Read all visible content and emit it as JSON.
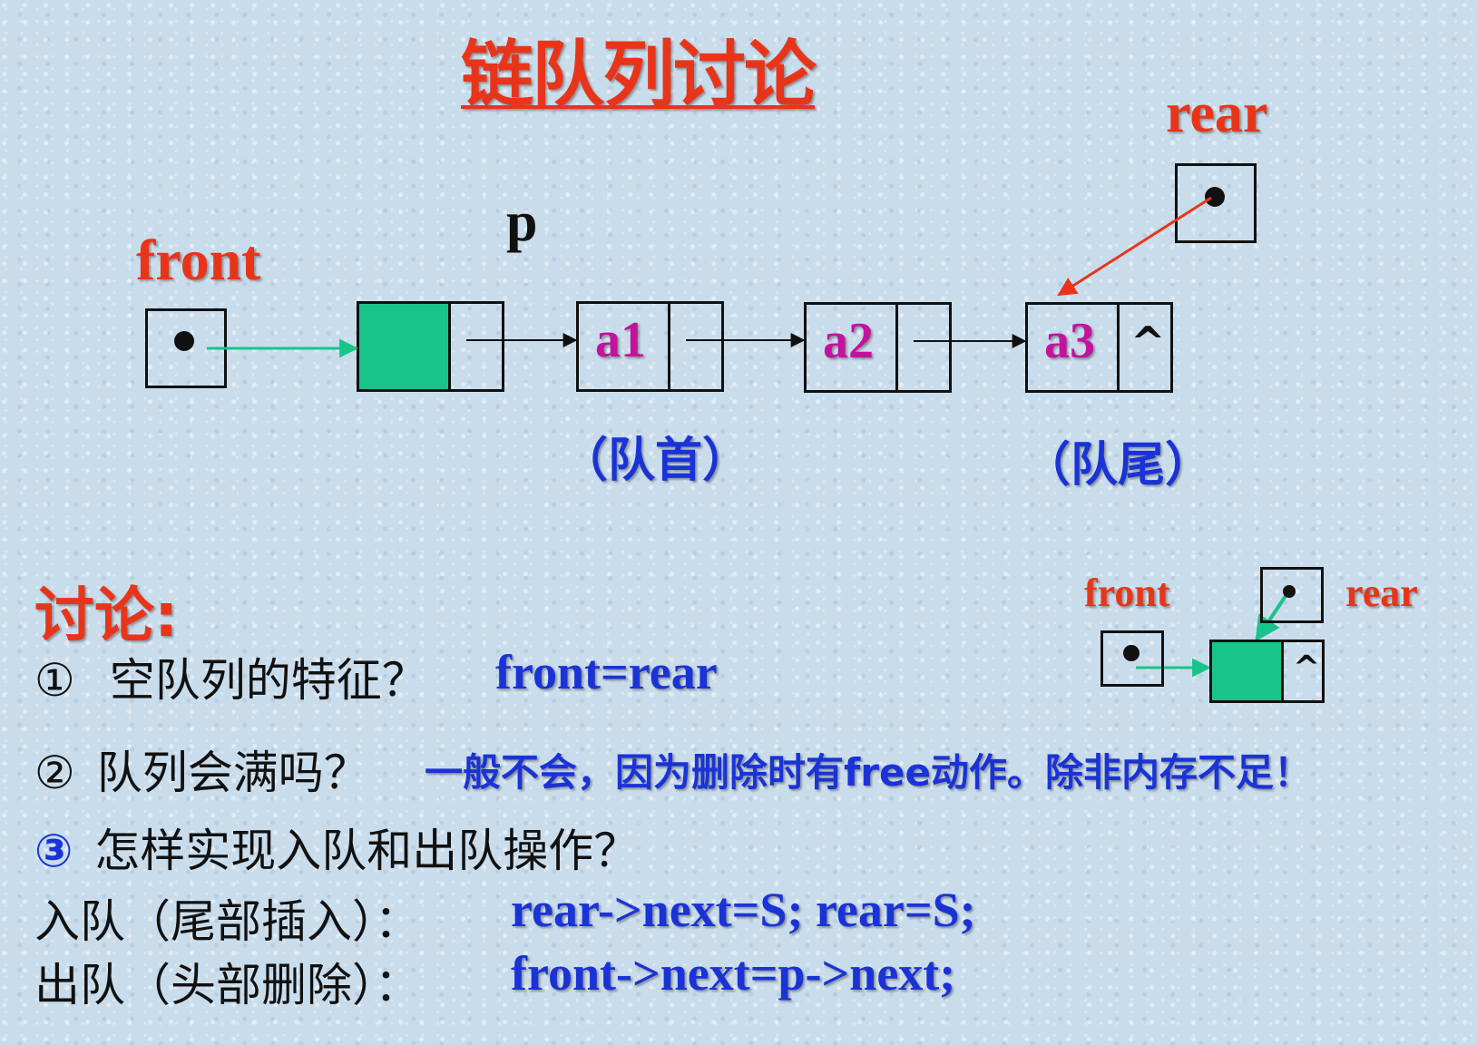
{
  "title": "链队列讨论",
  "diagram": {
    "front_label": "front",
    "rear_label": "rear",
    "p_label": "p",
    "nodes": [
      "a1",
      "a2",
      "a3"
    ],
    "null_mark": "^",
    "head_caption": "（队首）",
    "tail_caption": "（队尾）"
  },
  "discussion": {
    "heading": "讨论:",
    "q1_num": "①",
    "q1_text": "空队列的特征？",
    "q1_answer": "front=rear",
    "q2_num": "②",
    "q2_text": "队列会满吗？",
    "q2_answer": "一般不会，因为删除时有free动作。除非内存不足！",
    "q3_num": "③",
    "q3_text": "怎样实现入队和出队操作？",
    "enqueue_label": "入队（尾部插入）：",
    "enqueue_code": "rear->next=S; rear=S;",
    "dequeue_label": "出队（头部删除）：",
    "dequeue_code": "front->next=p->next;"
  },
  "mini_diagram": {
    "front_label": "front",
    "rear_label": "rear",
    "null_mark": "^"
  },
  "colors": {
    "title_red": "#e8351a",
    "code_blue": "#1a33d6",
    "node_purple": "#c4129e",
    "head_green": "#19c48a",
    "arrow_green": "#19c48a",
    "arrow_red": "#e8351a"
  }
}
